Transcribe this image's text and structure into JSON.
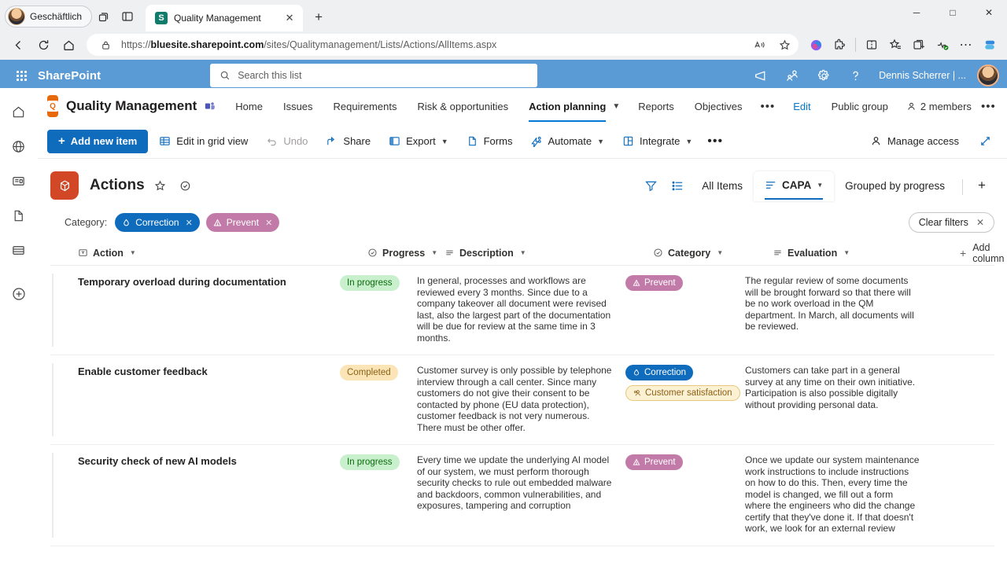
{
  "browser": {
    "profile_label": "Geschäftlich",
    "tab_title": "Quality Management",
    "tab_favicon_letter": "S",
    "url_prefix": "https://",
    "url_domain": "bluesite.sharepoint.com",
    "url_path": "/sites/Qualitymanagement/Lists/Actions/AllItems.aspx",
    "icons": {
      "back": "back-arrow-icon",
      "refresh": "refresh-icon",
      "home": "home-icon",
      "lock": "lock-icon",
      "read_aloud": "read-aloud-icon",
      "favorite": "star-icon",
      "copilot": "copilot-icon",
      "extensions": "extensions-icon",
      "split_screen": "split-screen-icon",
      "favorites_bar": "favorites-icon",
      "collections": "collections-icon",
      "browser_essentials": "browser-essentials-icon",
      "settings_more": "more-options-icon",
      "sidebar_copilot": "copilot-sidebar-icon"
    },
    "window": {
      "minimize": "─",
      "maximize": "□",
      "close": "✕"
    }
  },
  "suitebar": {
    "waffle": "app-launcher-icon",
    "brand": "SharePoint",
    "search_placeholder": "Search this list",
    "user_name": "Dennis Scherrer | ...",
    "icons": [
      "megaphone-icon",
      "teams-icon",
      "settings-gear-icon",
      "help-icon"
    ]
  },
  "rail": {
    "items": [
      {
        "name": "home-icon"
      },
      {
        "name": "globe-icon"
      },
      {
        "name": "news-feed-icon"
      },
      {
        "name": "documents-icon"
      },
      {
        "name": "lists-icon"
      },
      {
        "name": "create-icon"
      }
    ]
  },
  "sitenav": {
    "site_title": "Quality Management",
    "teams_icon": "teams-channel-icon",
    "links": [
      {
        "label": "Home",
        "active": false
      },
      {
        "label": "Issues",
        "active": false
      },
      {
        "label": "Requirements",
        "active": false
      },
      {
        "label": "Risk & opportunities",
        "active": false
      },
      {
        "label": "Action planning",
        "active": true
      },
      {
        "label": "Reports",
        "active": false
      },
      {
        "label": "Objectives",
        "active": false
      }
    ],
    "overflow": "•••",
    "edit_label": "Edit",
    "public_group_label": "Public group",
    "members_label": "2 members",
    "settings_dots": "•••"
  },
  "commandbar": {
    "add_new_item": "Add new item",
    "items": [
      {
        "label": "Edit in grid view",
        "icon": "grid-view-icon",
        "disabled": false,
        "chevron": false
      },
      {
        "label": "Undo",
        "icon": "undo-icon",
        "disabled": true,
        "chevron": false
      },
      {
        "label": "Share",
        "icon": "share-icon",
        "disabled": false,
        "chevron": false
      },
      {
        "label": "Export",
        "icon": "export-icon",
        "disabled": false,
        "chevron": true
      },
      {
        "label": "Forms",
        "icon": "forms-icon",
        "disabled": false,
        "chevron": false
      },
      {
        "label": "Automate",
        "icon": "automate-icon",
        "disabled": false,
        "chevron": true
      },
      {
        "label": "Integrate",
        "icon": "integrate-icon",
        "disabled": false,
        "chevron": true
      }
    ],
    "overflow": "•••",
    "manage_access": "Manage access",
    "fullscreen_icon": "expand-icon"
  },
  "listheader": {
    "title": "Actions",
    "list_icon": "list-cube-icon",
    "favorite_icon": "star-icon",
    "published_icon": "check-circle-icon",
    "filter_icon": "filter-icon",
    "view_options_icon": "view-options-icon",
    "views": [
      {
        "label": "All Items",
        "active": false,
        "icon": null
      },
      {
        "label": "CAPA",
        "active": true,
        "icon": "list-view-icon",
        "chevron": "⌄"
      },
      {
        "label": "Grouped by progress",
        "active": false,
        "icon": null
      }
    ],
    "add_view": "+"
  },
  "filters": {
    "label": "Category:",
    "pills": [
      {
        "label": "Correction",
        "icon": "droplet-icon",
        "style": "correction"
      },
      {
        "label": "Prevent",
        "icon": "warning-triangle-icon",
        "style": "prevent"
      }
    ],
    "clear_label": "Clear filters"
  },
  "table": {
    "columns": [
      {
        "label": "Action",
        "icon": "text-column-icon"
      },
      {
        "label": "Progress",
        "icon": "choice-column-icon"
      },
      {
        "label": "Description",
        "icon": "multiline-text-icon"
      },
      {
        "label": "Category",
        "icon": "choice-column-icon"
      },
      {
        "label": "Evaluation",
        "icon": "multiline-text-icon"
      }
    ],
    "add_column": "Add column",
    "rows": [
      {
        "action": "Temporary overload during documentation",
        "progress": {
          "label": "In progress",
          "style": "inprogress"
        },
        "description": "In general, processes and workflows are reviewed every 3 months. Since due to a company takeover all document were revised last, also the largest part of the documentation will be due for review at the same time in 3 months.",
        "categories": [
          {
            "label": "Prevent",
            "style": "prevent",
            "icon": "warning-triangle-icon"
          }
        ],
        "evaluation": "The regular review of some documents will be brought forward so that there will be no work overload in the QM department. In March, all documents will be reviewed."
      },
      {
        "action": "Enable customer feedback",
        "progress": {
          "label": "Completed",
          "style": "completed"
        },
        "description": "Customer survey is only possible by telephone interview through a call center. Since many customers do not give their consent to be contacted by phone (EU data protection), customer feedback is not very numerous. There must be other offer.",
        "categories": [
          {
            "label": "Correction",
            "style": "correction",
            "icon": "droplet-icon"
          },
          {
            "label": "Customer satisfaction",
            "style": "customersat",
            "icon": "people-icon"
          }
        ],
        "evaluation": "Customers can take part in a general survey at any time on their own initiative. Participation is also possible digitally without providing personal data."
      },
      {
        "action": "Security check of new AI models",
        "progress": {
          "label": "In progress",
          "style": "inprogress"
        },
        "description": "Every time we update the underlying AI model of our system, we must perform thorough security checks to rule out embedded malware and backdoors, common vulnerabilities, and exposures, tampering and corruption",
        "categories": [
          {
            "label": "Prevent",
            "style": "prevent",
            "icon": "warning-triangle-icon"
          }
        ],
        "evaluation": "Once we update our system maintenance work instructions to include instructions on how to do this. Then, every time the model is changed, we fill out a form where the engineers who did the change certify that they've done it. If that doesn't work, we look for an external review"
      }
    ]
  },
  "colors": {
    "suitebar": "#5b9bd5",
    "accent": "#0f6cbd",
    "list_icon": "#d24726",
    "site_logo": "#e8690b",
    "prevent": "#c27ba8",
    "inprogress_bg": "#c8f0cd",
    "completed_bg": "#fbe5b6"
  }
}
